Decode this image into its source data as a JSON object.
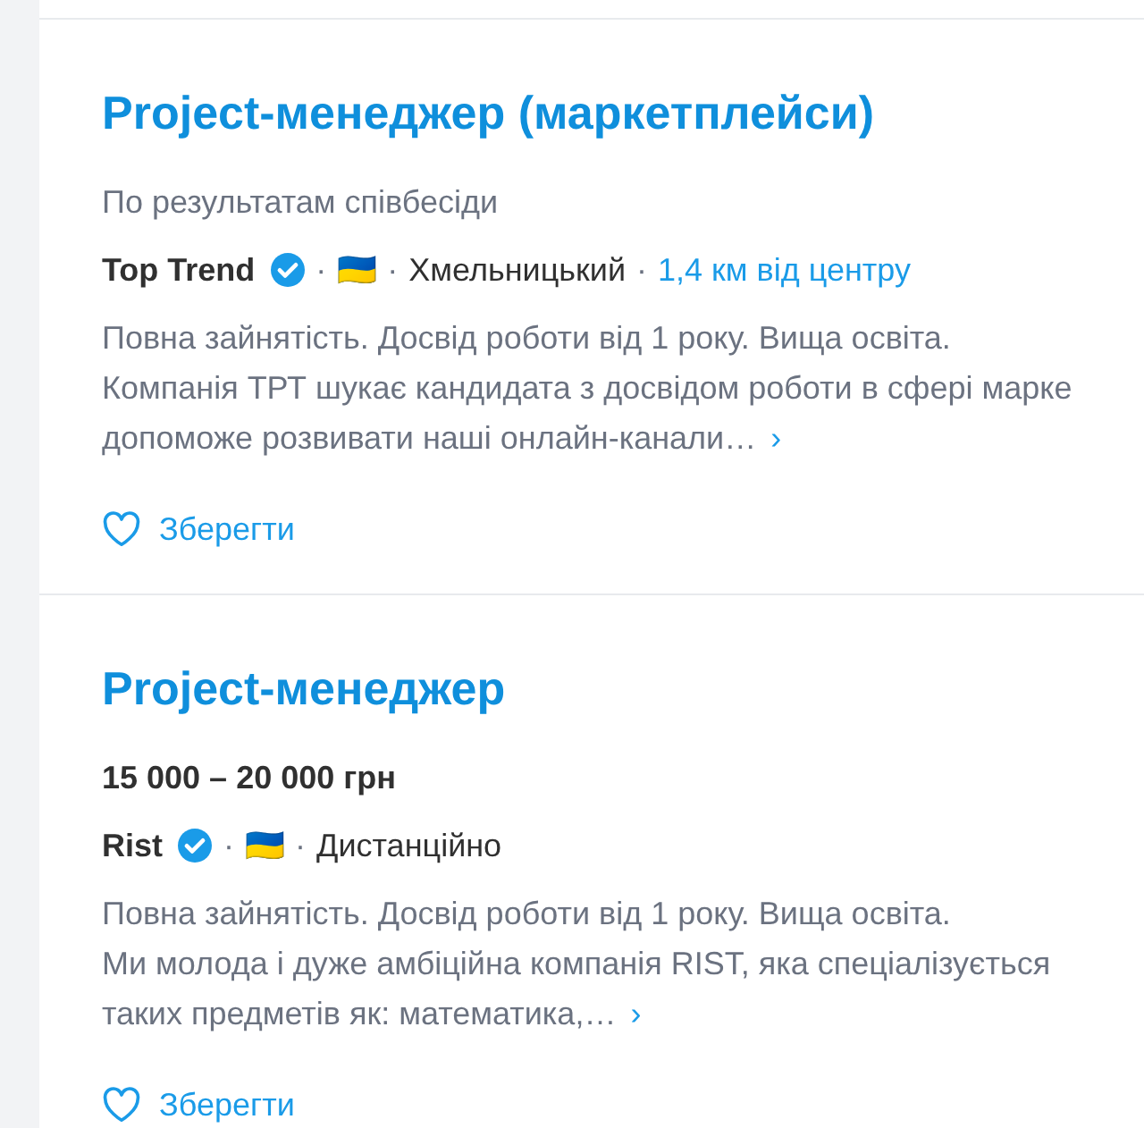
{
  "vacancies": [
    {
      "title": "Project-менеджер (маркетплейси)",
      "pay": {
        "kind": "note",
        "text": "По результатам співбесіди"
      },
      "separator": "·",
      "company": "Top Trend",
      "verified": true,
      "flag": "🇺🇦",
      "location": "Хмельницький",
      "distance": "1,4 км від центру",
      "description": [
        "Повна зайнятість. Досвід роботи від 1 року. Вища освіта.",
        "Компанія ТРТ шукає кандидата з досвідом роботи в сфері марке",
        "допоможе розвивати наші онлайн-канали…"
      ],
      "more": "›",
      "save": "Зберегти"
    },
    {
      "title": "Project-менеджер",
      "pay": {
        "kind": "salary",
        "text": "15 000 – 20 000 грн"
      },
      "separator": "·",
      "company": "Rist",
      "verified": true,
      "flag": "🇺🇦",
      "location": "Дистанційно",
      "description": [
        "Повна зайнятість. Досвід роботи від 1 року. Вища освіта.",
        "Ми молода і дуже амбіційна компанія RIST, яка спеціалізується",
        "таких предметів як: математика,…"
      ],
      "more": "›",
      "save": "Зберегти"
    }
  ]
}
